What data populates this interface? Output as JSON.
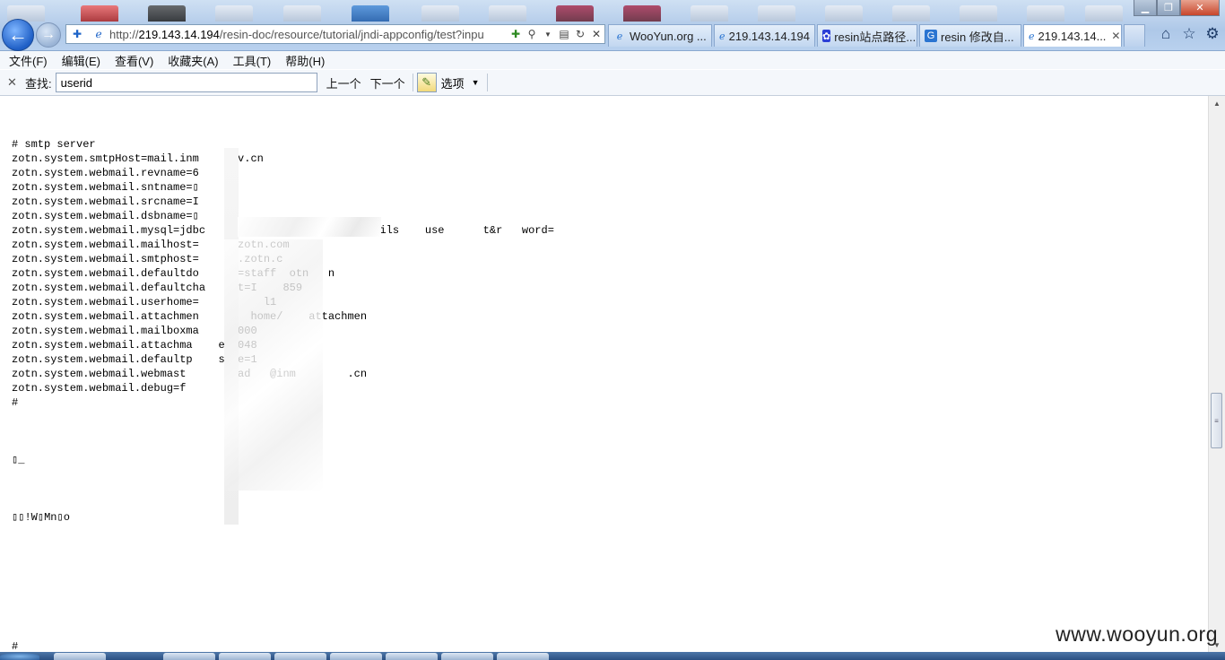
{
  "browser": {
    "address_url_gray_prefix": "http://",
    "address_url_host": "219.143.14.194",
    "address_url_path": "/resin-doc/resource/tutorial/jndi-appconfig/test?inpu",
    "tabs": [
      {
        "label": "WooYun.org ...",
        "icon": "ie-icon",
        "color": "#2a74d1"
      },
      {
        "label": "219.143.14.194",
        "icon": "ie-icon",
        "color": "#2a74d1"
      },
      {
        "label": "resin站点路径...",
        "icon": "baidu-paw-icon",
        "color": "#2c3fd6"
      },
      {
        "label": "resin 修改自...",
        "icon": "google-g-icon",
        "color": "#2a74d1"
      },
      {
        "label": "219.143.14...",
        "icon": "ie-icon",
        "color": "#2a74d1",
        "active": true,
        "close": "✕"
      }
    ]
  },
  "menu": {
    "items": [
      "文件(F)",
      "编辑(E)",
      "查看(V)",
      "收藏夹(A)",
      "工具(T)",
      "帮助(H)"
    ]
  },
  "findbar": {
    "close": "✕",
    "label": "查找:",
    "value": "userid",
    "prev": "上一个",
    "next": "下一个",
    "options": "选项",
    "options_arrow": "▼"
  },
  "content": {
    "lines": [
      "# smtp server",
      "zotn.system.smtpHost=mail.inm    gov.cn",
      "zotn.system.webmail.revname=6",
      "zotn.system.webmail.sntname=▯",
      "zotn.system.webmail.srcname=I",
      "zotn.system.webmail.dsbname=▯",
      "zotn.system.webmail.mysql=jdbc        ,/localh      0f  uils    use      t&r   word=",
      "zotn.system.webmail.mailhost=     .zotn.com",
      "zotn.system.webmail.smtphost=    ff.zotn.c",
      "zotn.system.webmail.defaultdo     n=staff  otn   n",
      "zotn.system.webmail.defaultcha    et=I    859",
      "zotn.system.webmail.userhome=    me    l1",
      "zotn.system.webmail.attachmen    o   home/    attachmen",
      "zotn.system.webmail.mailboxma    =1000",
      "zotn.system.webmail.attachma    e=1048",
      "zotn.system.webmail.defaultp    size=1",
      "zotn.system.webmail.webmast      l=ad   @inm        .cn",
      "zotn.system.webmail.debug=f",
      "#",
      "",
      "",
      "",
      "▯_",
      "",
      "",
      "",
      "▯▯!W▯Mn▯o",
      "",
      "",
      "",
      "",
      "",
      "",
      "",
      "",
      "#"
    ]
  },
  "watermark": "www.wooyun.org"
}
